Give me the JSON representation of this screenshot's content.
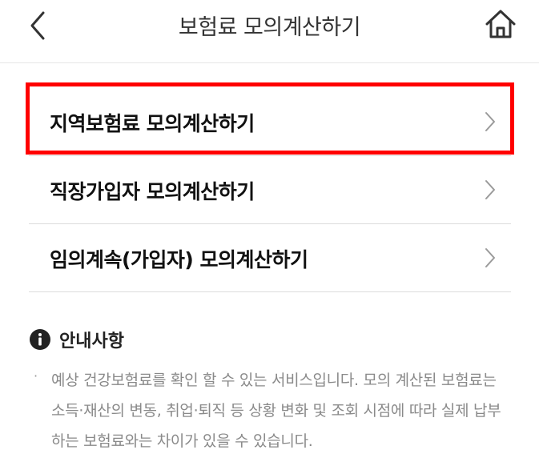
{
  "header": {
    "title": "보험료 모의계산하기",
    "back_icon": "chevron-left-icon",
    "home_icon": "home-icon"
  },
  "menu": {
    "items": [
      {
        "label": "지역보험료 모의계산하기",
        "icon": "chevron-right-icon",
        "highlighted": true
      },
      {
        "label": "직장가입자 모의계산하기",
        "icon": "chevron-right-icon",
        "highlighted": false
      },
      {
        "label": "임의계속(가입자) 모의계산하기",
        "icon": "chevron-right-icon",
        "highlighted": false
      }
    ],
    "highlight_color": "#ff0000"
  },
  "notice": {
    "icon": "info-icon",
    "title": "안내사항",
    "bullet": "·",
    "text": "예상 건강보험료를 확인 할 수 있는 서비스입니다. 모의 계산된 보험료는 소득·재산의 변동, 취업·퇴직 등 상황 변화 및 조회 시점에 따라 실제 납부하는 보험료와는 차이가 있을 수 있습니다."
  }
}
